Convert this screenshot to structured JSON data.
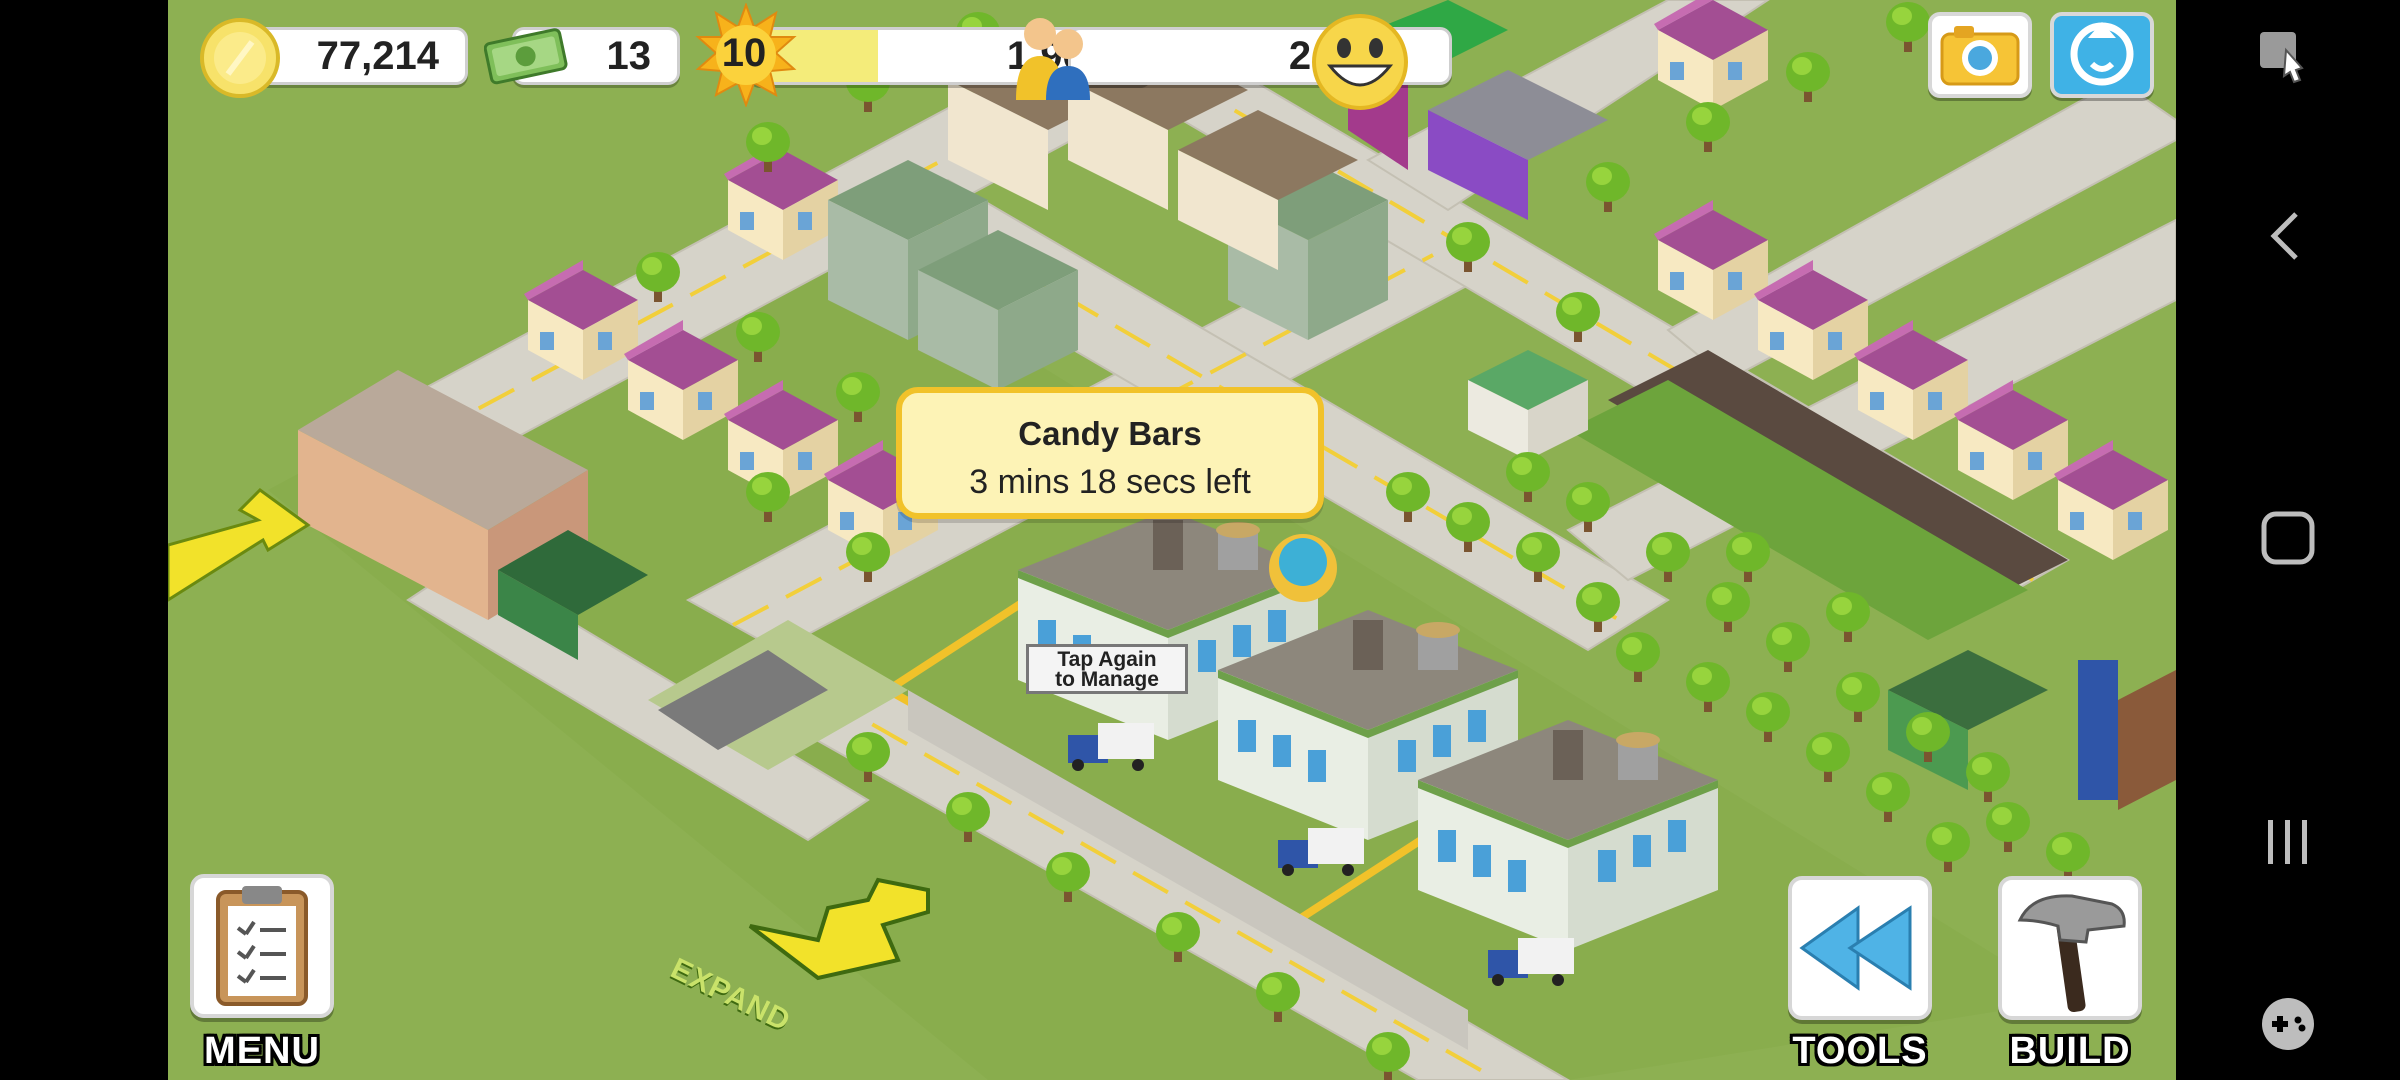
{
  "hud": {
    "coins": "77,214",
    "cash": "13",
    "level": "10",
    "xp": "1,965",
    "xp_progress": 0.32,
    "population": "2,960"
  },
  "tooltip": {
    "title": "Candy Bars",
    "subtitle": "3 mins 18 secs left"
  },
  "sign": {
    "line1": "Tap Again",
    "line2": "to Manage"
  },
  "buttons": {
    "menu": "MENU",
    "tools": "TOOLS",
    "build": "BUILD",
    "expand": "EXPAND"
  },
  "colors": {
    "grass": "#8db052",
    "road": "#d6d3c9",
    "highlight": "#f1c22a",
    "button_blue": "#3fb2e6"
  },
  "icons": {
    "coin": "coin-icon",
    "cash": "cash-icon",
    "level": "star-burst-icon",
    "population": "people-icon",
    "happiness": "smiley-icon",
    "camera": "camera-icon",
    "share": "share-icon"
  }
}
